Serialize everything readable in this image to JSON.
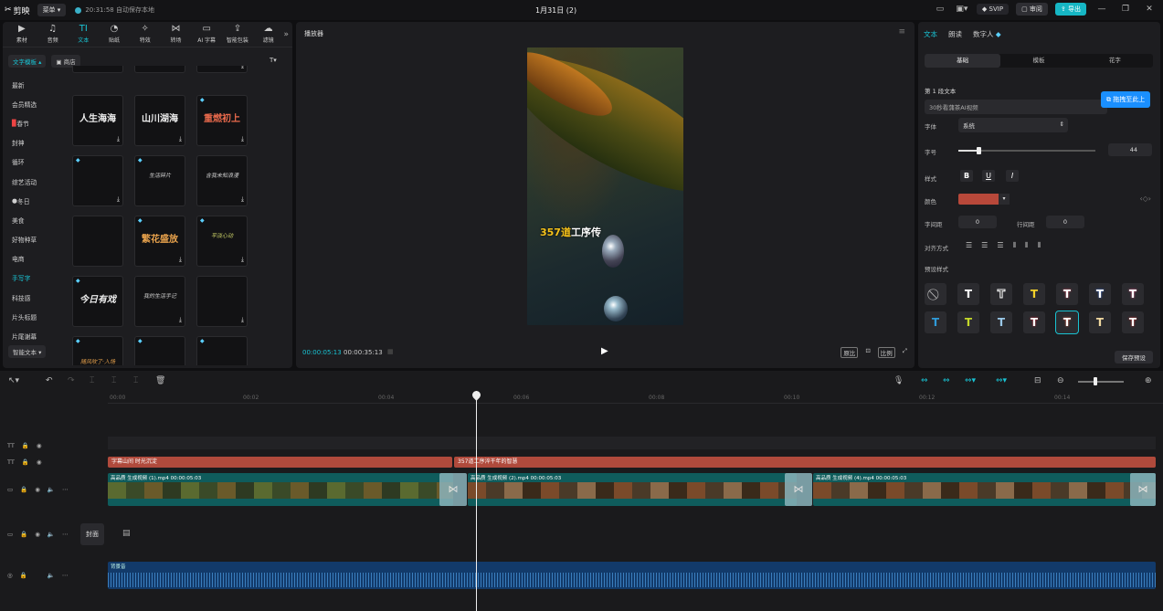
{
  "topbar": {
    "app_name": "剪映",
    "menu_label": "菜单",
    "save_status": "20:31:58 自动保存本地",
    "project_title": "1月31日 (2)",
    "svip": "SVIP",
    "review": "审阅",
    "export": "导出"
  },
  "tools": [
    "素材",
    "音频",
    "文本",
    "贴纸",
    "特效",
    "转场",
    "AI 字幕",
    "智能包装",
    "滤镜"
  ],
  "left": {
    "category_dropdown": "文字模板",
    "shop_label": "商店",
    "sort_label": "T▾",
    "categories": [
      "最新",
      "会员精选",
      "春节",
      "封神",
      "循环",
      "综艺活动",
      "冬日",
      "美食",
      "好物种草",
      "电商",
      "手写字",
      "科技感",
      "片头标题",
      "片尾谢幕"
    ],
    "smart_text": "智能文本",
    "cards": [
      "人生海海",
      "山川湖海",
      "重燃初上",
      "",
      "生活碎片",
      "含我未知浪漫",
      "",
      "繁花盛放",
      "平淡心动",
      "今日有戏",
      "我的生活手记",
      "",
      "随风吹了·入场",
      "",
      ""
    ]
  },
  "player": {
    "title": "播放器",
    "subtitle_highlight": "357道",
    "subtitle_rest": "工序传",
    "time_current": "00:00:05:13",
    "time_total": "00:00:35:13",
    "controls": [
      "原比",
      "比例"
    ]
  },
  "right": {
    "tabs": [
      "文本",
      "朗读",
      "数字人"
    ],
    "segments": [
      "基础",
      "模板",
      "花字"
    ],
    "section_title": "第 1 段文本",
    "text_value": "30秒看蒲茶AI视频",
    "drag_tip": "拖拽至此上",
    "font_label": "字体",
    "font_value": "系统",
    "size_label": "字号",
    "size_value": "44",
    "style_label": "样式",
    "color_label": "颜色",
    "spacing_label": "字间距",
    "spacing_value": "0",
    "line_label": "行间距",
    "line_value": "0",
    "align_label": "对齐方式",
    "preset_label": "预设样式",
    "save_preset": "保存预设"
  },
  "timeline": {
    "ruler": [
      "00:00",
      "00:02",
      "00:04",
      "00:06",
      "00:08",
      "00:10",
      "00:12",
      "00:14"
    ],
    "text_clips": [
      "字幕山间 时光沉淀",
      "357道工序淬干年的智慧"
    ],
    "video_clips": [
      {
        "name": "高品质 生成视频 (1).mp4",
        "dur": "00:00:05:03"
      },
      {
        "name": "高品质 生成视频 (2).mp4",
        "dur": "00:00:05:03"
      },
      {
        "name": "高品质 生成视频 (4).mp4",
        "dur": "00:00:05:03"
      }
    ],
    "cover": "封面",
    "audio": "背景音"
  },
  "colors": {
    "accent": "#19c3d3",
    "text_clip": "#b04a3c",
    "video_clip": "#0f5c5c",
    "audio_clip": "#123a6a"
  }
}
